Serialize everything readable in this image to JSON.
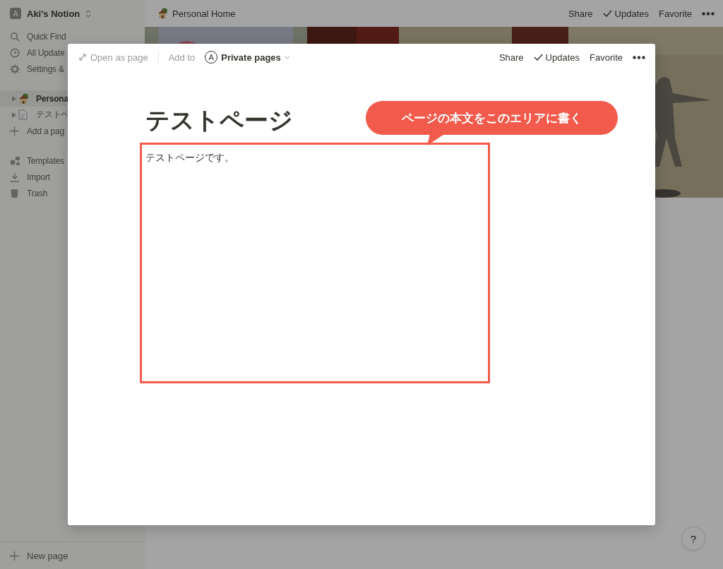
{
  "sidebar": {
    "workspace": {
      "avatar": "A",
      "name": "Aki's Notion"
    },
    "actions": [
      {
        "kind": "search",
        "label": "Quick Find"
      },
      {
        "kind": "clock",
        "label": "All Update"
      },
      {
        "kind": "gear",
        "label": "Settings &"
      }
    ],
    "pages": [
      {
        "kind": "house",
        "label": "Persona",
        "selected": true,
        "expanded": false
      },
      {
        "kind": "doc",
        "label": "テストペ",
        "selected": false,
        "expanded": false
      },
      {
        "kind": "add",
        "label": "Add a pag",
        "selected": false
      }
    ],
    "tools": [
      {
        "kind": "templates",
        "label": "Templates"
      },
      {
        "kind": "import",
        "label": "Import"
      },
      {
        "kind": "trash",
        "label": "Trash"
      }
    ],
    "new_page": "New page"
  },
  "topbar": {
    "breadcrumb": "Personal Home",
    "share": "Share",
    "updates": "Updates",
    "favorite": "Favorite"
  },
  "modal": {
    "open_as_page": "Open as page",
    "add_to": "Add to",
    "space_avatar": "A",
    "space": "Private pages",
    "share": "Share",
    "updates": "Updates",
    "favorite": "Favorite",
    "title": "テストページ",
    "body": "テストページです。",
    "callout": "ページの本文をこのエリアに書く"
  },
  "help": "?"
}
